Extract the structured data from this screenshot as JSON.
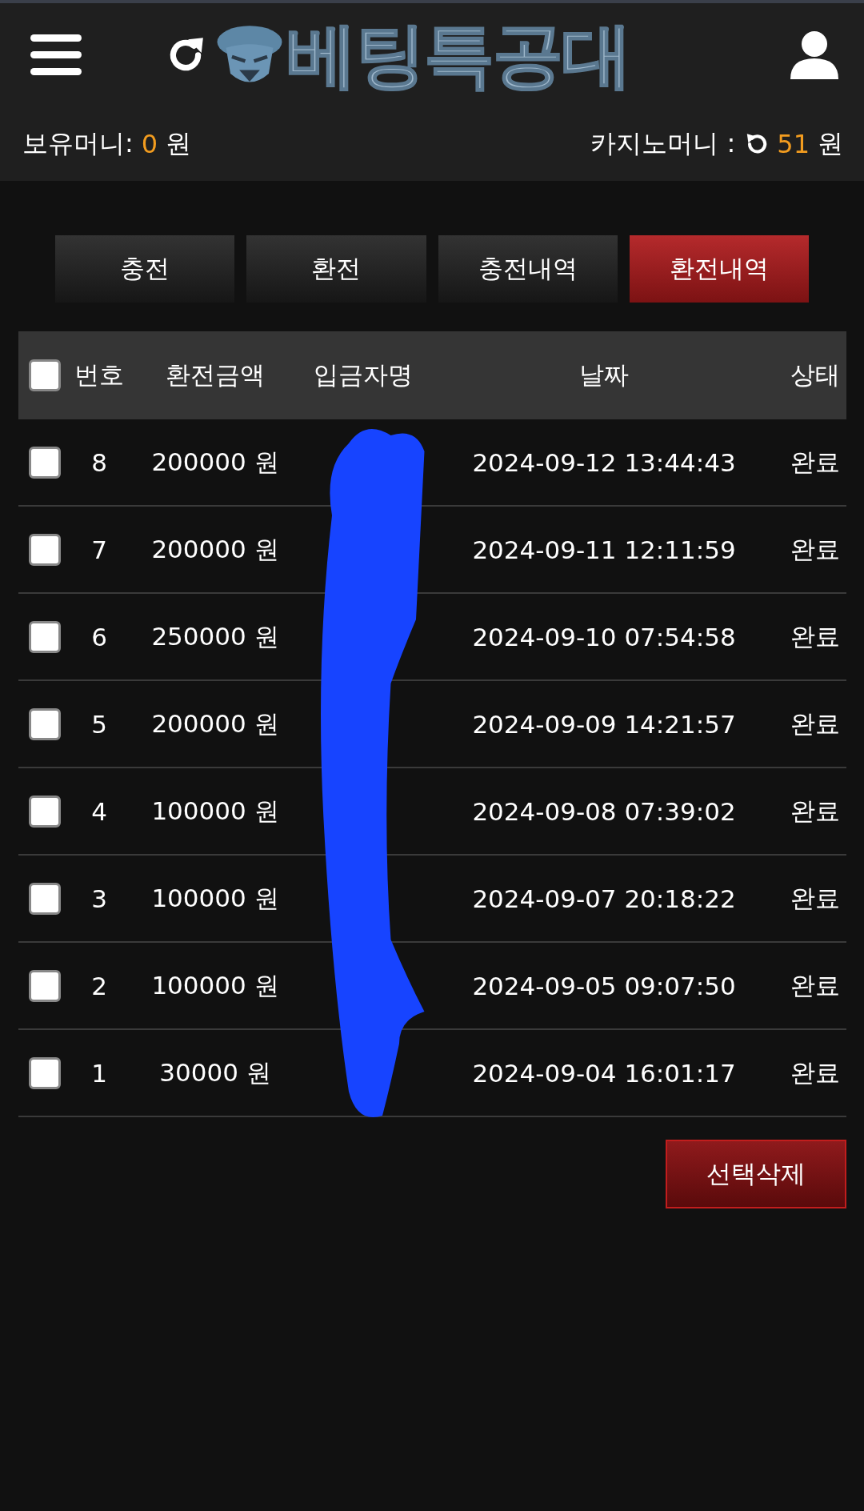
{
  "header": {
    "logo_text": "베팅특공대",
    "balance_label": "보유머니:",
    "balance_value": "0",
    "balance_unit": "원",
    "casino_label": "카지노머니 :",
    "casino_value": "51",
    "casino_unit": "원"
  },
  "tabs": [
    {
      "label": "충전",
      "selected": false
    },
    {
      "label": "환전",
      "selected": false
    },
    {
      "label": "충전내역",
      "selected": false
    },
    {
      "label": "환전내역",
      "selected": true
    }
  ],
  "table": {
    "select_all_checked": false,
    "columns": [
      "번호",
      "환전금액",
      "입금자명",
      "날짜",
      "상태"
    ],
    "rows": [
      {
        "checked": false,
        "number": "8",
        "amount": "200000 원",
        "date": "2024-09-12 13:44:43",
        "status": "완료"
      },
      {
        "checked": false,
        "number": "7",
        "amount": "200000 원",
        "date": "2024-09-11 12:11:59",
        "status": "완료"
      },
      {
        "checked": false,
        "number": "6",
        "amount": "250000 원",
        "date": "2024-09-10 07:54:58",
        "status": "완료"
      },
      {
        "checked": false,
        "number": "5",
        "amount": "200000 원",
        "date": "2024-09-09 14:21:57",
        "status": "완료"
      },
      {
        "checked": false,
        "number": "4",
        "amount": "100000 원",
        "date": "2024-09-08 07:39:02",
        "status": "완료"
      },
      {
        "checked": false,
        "number": "3",
        "amount": "100000 원",
        "date": "2024-09-07 20:18:22",
        "status": "완료"
      },
      {
        "checked": false,
        "number": "2",
        "amount": "100000 원",
        "date": "2024-09-05 09:07:50",
        "status": "완료"
      },
      {
        "checked": false,
        "number": "1",
        "amount": "30000 원",
        "date": "2024-09-04 16:01:17",
        "status": "완료"
      }
    ]
  },
  "delete_button": "선택삭제"
}
